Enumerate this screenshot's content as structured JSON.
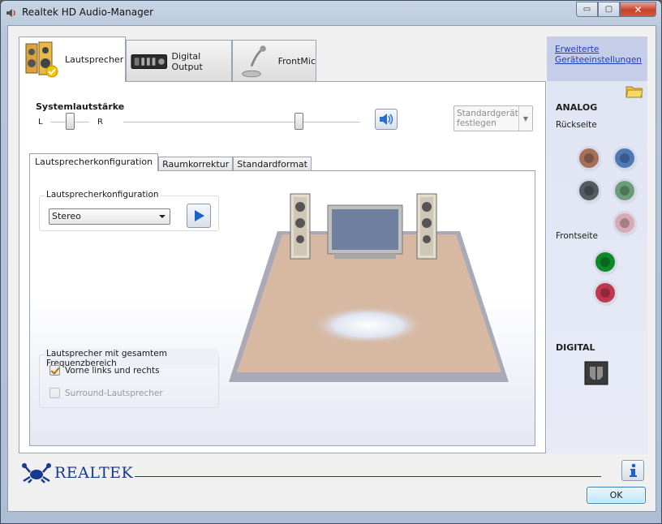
{
  "window": {
    "title": "Realtek HD Audio-Manager",
    "controls": {
      "minimize": "▭",
      "maximize": "▢",
      "close": "✕"
    }
  },
  "device_tabs": [
    {
      "label": "Lautsprecher",
      "icon": "speaker-device-icon",
      "active": true
    },
    {
      "label": "Digital Output",
      "icon": "digital-output-device-icon",
      "active": false
    },
    {
      "label": "FrontMic",
      "icon": "microphone-device-icon",
      "active": false
    }
  ],
  "volume": {
    "label": "Systemlautstärke",
    "left_label": "L",
    "right_label": "R",
    "balance_fraction": 0.5,
    "level_fraction": 0.74,
    "mute_icon": "speaker-volume-icon"
  },
  "default_device_button": {
    "label": "Standardgerät festlegen",
    "enabled": false
  },
  "sub_tabs": [
    {
      "label": "Lautsprecherkonfiguration",
      "active": true
    },
    {
      "label": "Raumkorrektur",
      "active": false
    },
    {
      "label": "Standardformat",
      "active": false
    }
  ],
  "speaker_config": {
    "group_label": "Lautsprecherkonfiguration",
    "selected": "Stereo",
    "play_icon": "play-icon"
  },
  "fullrange": {
    "group_label": "Lautsprecher mit gesamtem Frequenzbereich",
    "options": [
      {
        "label": "Vorne links und rechts",
        "checked": true,
        "enabled": true
      },
      {
        "label": "Surround-Lautsprecher",
        "checked": false,
        "enabled": false
      }
    ]
  },
  "side": {
    "advanced_link": "Erweiterte Geräteeinstellungen",
    "folder_icon": "folder-icon",
    "analog_heading": "ANALOG",
    "rear_label": "Rückseite",
    "front_label": "Frontseite",
    "digital_heading": "DIGITAL",
    "rear_jacks": [
      {
        "color": "#a3705a",
        "name": "jack-rear-orange"
      },
      {
        "color": "#4f78b8",
        "name": "jack-rear-blue"
      },
      {
        "color": "#565a62",
        "name": "jack-rear-black"
      },
      {
        "color": "#6c9d7a",
        "name": "jack-rear-green"
      },
      {
        "color": "#d8a9b4",
        "name": "jack-rear-pink"
      }
    ],
    "front_jacks": [
      {
        "color": "#0e8a2a",
        "name": "jack-front-green"
      },
      {
        "color": "#c0384e",
        "name": "jack-front-pink"
      }
    ]
  },
  "footer": {
    "brand": "REALTEK",
    "info_icon": "info-icon",
    "ok_label": "OK"
  }
}
